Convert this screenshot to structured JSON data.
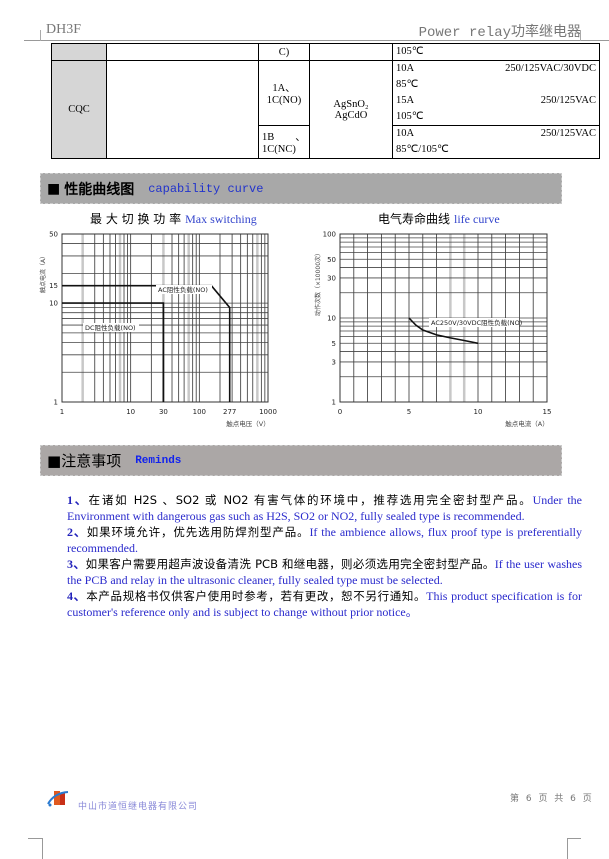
{
  "header": {
    "model": "DH3F",
    "title": "Power relay功率继电器"
  },
  "spec_table": {
    "top_row": {
      "col2": "C)",
      "col4": "105℃"
    },
    "cqc_row": {
      "cert": "CQC",
      "form_no": [
        "1A、",
        "1C(NO)"
      ],
      "form_nc": [
        "1B　　、",
        "1C(NC)"
      ],
      "material": [
        "AgSnO₂",
        "AgCdO"
      ],
      "no_ratings": [
        {
          "current": "10A",
          "voltage": "250/125VAC/30VDC"
        },
        {
          "current": "85℃",
          "voltage": ""
        },
        {
          "current": "15A",
          "voltage": "250/125VAC"
        },
        {
          "current": "105℃",
          "voltage": ""
        }
      ],
      "nc_ratings": [
        {
          "current": "10A",
          "voltage": "250/125VAC"
        },
        {
          "current": "85℃/105℃",
          "voltage": ""
        }
      ]
    }
  },
  "section_capability": {
    "icon": "■",
    "title": "性能曲线图",
    "en": "capability curve"
  },
  "chart_data": [
    {
      "type": "line",
      "title_cn": "最 大 切 换 功 率",
      "title_en": "Max switching",
      "xlabel": "触点电压（V）",
      "ylabel": "触点电流（A）",
      "xscale": "log",
      "yscale": "log",
      "xlim": [
        1,
        1000
      ],
      "ylim": [
        1,
        50
      ],
      "xticks": [
        1,
        10,
        30,
        100,
        277,
        1000
      ],
      "yticks": [
        1,
        10,
        15,
        50
      ],
      "grid": true,
      "series": [
        {
          "name": "AC阻性负载(NO)",
          "x": [
            1,
            150,
            277,
            277
          ],
          "y": [
            15,
            15,
            9,
            1
          ]
        },
        {
          "name": "DC阻性负载(NO)",
          "x": [
            1,
            30,
            30
          ],
          "y": [
            10,
            10,
            1
          ]
        }
      ]
    },
    {
      "type": "line",
      "title_cn": "电气寿命曲线",
      "title_en": "life curve",
      "xlabel": "触点电流（A）",
      "ylabel": "动作次数（×10000次）",
      "xscale": "linear",
      "yscale": "log",
      "xlim": [
        0,
        15
      ],
      "ylim": [
        1,
        100
      ],
      "xticks": [
        0,
        5,
        10,
        15
      ],
      "yticks": [
        1,
        3,
        5,
        10,
        30,
        50,
        100
      ],
      "grid": true,
      "series": [
        {
          "name": "AC250V/30VDC阻性负载(NO)",
          "x": [
            5,
            5.5,
            6,
            7,
            8,
            9,
            10
          ],
          "y": [
            10,
            8.2,
            7.2,
            6.3,
            5.8,
            5.4,
            5
          ]
        }
      ]
    }
  ],
  "section_reminds": {
    "icon": "■",
    "title": "注意事项",
    "en": "Reminds"
  },
  "reminds": [
    {
      "num": "1、",
      "cn": "在诸如 H2S 、SO2 或 NO2 有害气体的环境中，推荐选用完全密封型产品。",
      "en": "Under the Environment with dangerous gas such as H2S, SO2 or NO2, fully sealed type is recommended."
    },
    {
      "num": "2、",
      "cn": "如果环境允许，优先选用防焊剂型产品。",
      "en": "If the ambience allows, flux proof type is preferentially recommended."
    },
    {
      "num": "3、",
      "cn": "如果客户需要用超声波设备清洗 PCB 和继电器，则必须选用完全密封型产品。",
      "en": "If the user washes the PCB and relay in the ultrasonic cleaner, fully sealed type must be selected."
    },
    {
      "num": "4、",
      "cn": "本产品规格书仅供客户使用时参考，若有更改，恕不另行通知。",
      "en": "This product specification is for customer's reference only and is subject to change without prior notice。"
    }
  ],
  "footer": {
    "company": "中山市道恒继电器有限公司",
    "page": "第 6 页 共 6 页"
  }
}
